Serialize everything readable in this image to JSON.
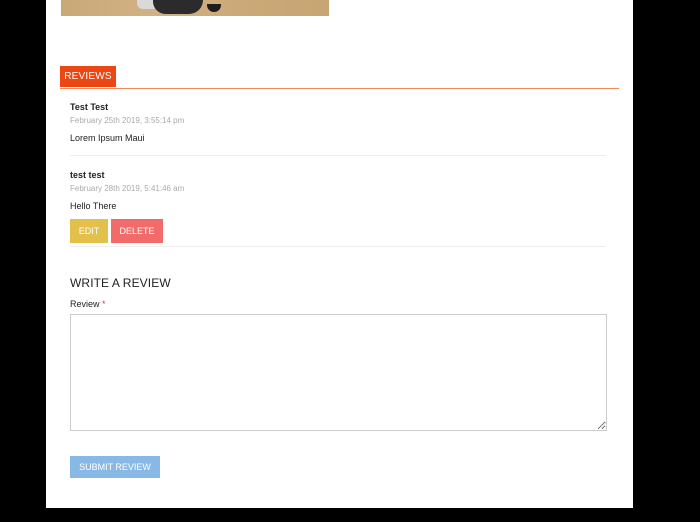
{
  "tabs": {
    "reviews_label": "REVIEWS"
  },
  "reviews": [
    {
      "author": "Test Test",
      "date": "February 25th 2019, 3:55:14 pm",
      "text": "Lorem Ipsum Maui"
    },
    {
      "author": "test test",
      "date": "February 28th 2019, 5:41:46 am",
      "text": "Hello There",
      "actions": {
        "edit_label": "EDIT",
        "delete_label": "DELETE"
      }
    }
  ],
  "form": {
    "title": "WRITE A REVIEW",
    "review_label": "Review",
    "required_marker": "*",
    "review_value": "",
    "submit_label": "SUBMIT REVIEW"
  },
  "colors": {
    "tab_active": "#ea4715",
    "edit_button": "#e3c04b",
    "delete_button": "#f36a6a",
    "submit_button": "#88b8e6",
    "required": "#e03a3a"
  },
  "icons": {
    "resize": "resize-grip-icon"
  }
}
